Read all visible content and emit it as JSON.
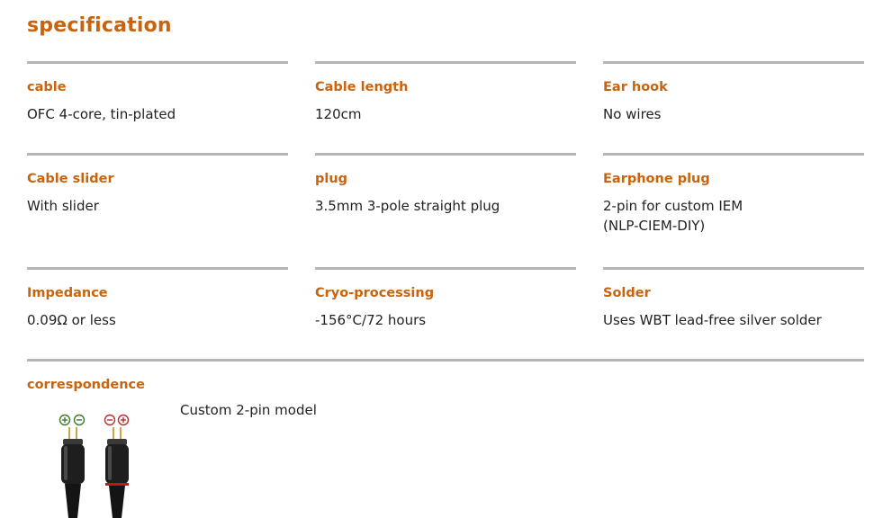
{
  "title": "specification",
  "specs": [
    {
      "label": "cable",
      "value": "OFC 4-core, tin-plated"
    },
    {
      "label": "Cable length",
      "value": "120cm"
    },
    {
      "label": "Ear hook",
      "value": "No wires"
    },
    {
      "label": "Cable slider",
      "value": "With slider"
    },
    {
      "label": "plug",
      "value": "3.5mm 3-pole straight plug"
    },
    {
      "label": "Earphone plug",
      "value_line1": "2-pin for custom IEM",
      "value_line2": "(NLP-CIEM-DIY)"
    },
    {
      "label": "Impedance",
      "value": "0.09Ω or less"
    },
    {
      "label": "Cryo-processing",
      "value": "-156°C/72 hours"
    },
    {
      "label": "Solder",
      "value": "Uses WBT lead-free silver solder"
    }
  ],
  "correspondence": {
    "label": "correspondence",
    "value": "Custom 2-pin model",
    "image": {
      "left_plug_symbols": [
        "⊕",
        "⊖"
      ],
      "right_plug_symbols": [
        "⊖",
        "⊕"
      ],
      "left_symbol_color": "#3a7a2a",
      "right_symbol_color": "#b03030"
    }
  },
  "colors": {
    "accent": "#c8640e",
    "rule": "#b5b5b5",
    "text": "#222222"
  }
}
